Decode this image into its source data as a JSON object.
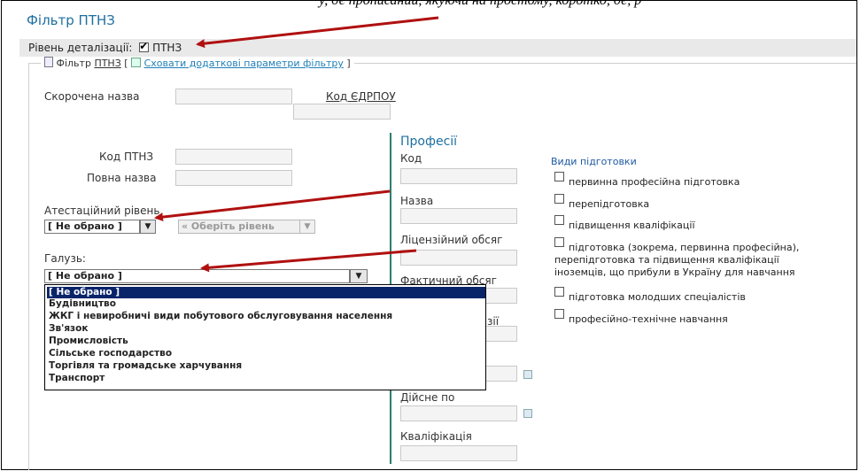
{
  "top_cut_text": "у, де прописаний, якуючи на простому, коротко, де, р",
  "title": "Фільтр ПТНЗ",
  "detail": {
    "label": "Рівень деталізації:",
    "checkbox_label": "ПТНЗ",
    "checked": true
  },
  "legend": {
    "prefix": "Фільтр",
    "abbr": "ПТНЗ",
    "open_bracket": "[",
    "link": "Сховати додаткові параметри фільтру",
    "close_bracket": "]"
  },
  "fields": {
    "short_name": "Скорочена назва",
    "edrpou": "Код ЄДРПОУ",
    "ptnz_code": "Код ПТНЗ",
    "full_name": "Повна назва",
    "attest_level": "Атестаційний рівень",
    "attest_select": "[ Не обрано ]",
    "level_select": "« Оберіть рівень",
    "branch": "Галузь:",
    "branch_select": "[ Не обрано ]"
  },
  "professions": {
    "title": "Професії",
    "code": "Код",
    "name": "Назва",
    "licensed": "Ліцензійний обсяг",
    "actual": "Фактичний обсяг",
    "partial_label": "зії",
    "valid_to": "Дійсне по",
    "qualification": "Кваліфікація"
  },
  "training_types": {
    "title": "Види підготовки",
    "items": [
      "первинна професійна підготовка",
      "перепідготовка",
      "підвищення кваліфікації",
      "підготовка (зокрема, первинна професійна),",
      "перепідготовка та підвищення кваліфікації",
      "іноземців, що прибули в Україну для навчання",
      "підготовка молодших спеціалістів",
      "професійно-технічне навчання"
    ]
  },
  "branch_options": [
    "[ Не обрано ]",
    "Будівництво",
    "ЖКГ і невиробничі види побутового обслуговування населення",
    "Зв'язок",
    "Промисловість",
    "Сільське господарство",
    "Торгівля та громадське харчування",
    "Транспорт"
  ],
  "colors": {
    "accent": "#1e6f9f",
    "annotation_arrow": "#b01010",
    "selected": "#0a246a"
  }
}
